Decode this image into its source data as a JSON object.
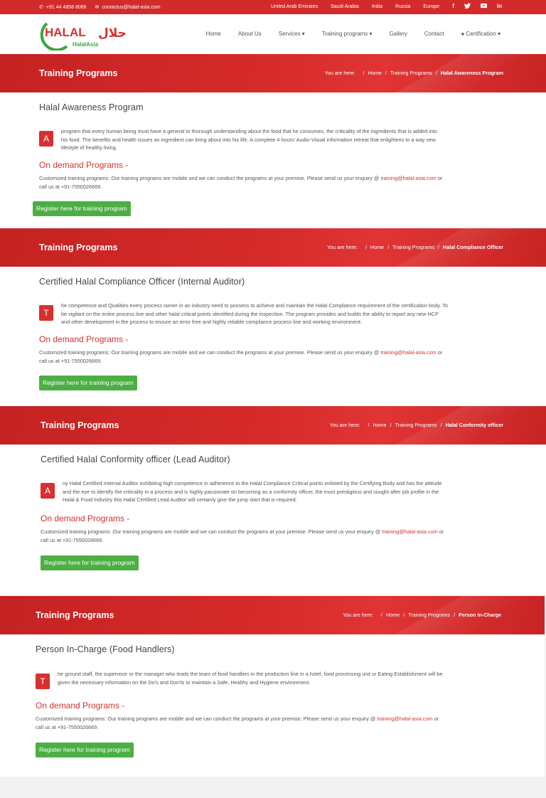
{
  "topbar": {
    "phone": "+91 44 4858 8066",
    "email": "contactus@halal-asia.com",
    "regions": [
      "United Arab Emirates",
      "Saudi Arabia",
      "India",
      "Russia",
      "Europe"
    ],
    "social": [
      "f",
      "t",
      "yt",
      "in"
    ]
  },
  "header": {
    "logo_text": "HALAL",
    "logo_subtext": "HalalAsia",
    "logo_arabic": "حلال",
    "nav": [
      "Home",
      "About Us",
      "Services ▾",
      "Training programs ▾",
      "Gallery",
      "Contact",
      "● Certification ▾"
    ]
  },
  "common": {
    "banner_title": "Training Programs",
    "you_are_here": "You are here:",
    "crumb_sep": "/",
    "crumb_home": "Home",
    "crumb_training": "Training Programs",
    "on_demand": "On demand Programs -",
    "custom_text": "Customized training programs: Our training programs are mobile and we can conduct the programs at your premise. Please send us your enquiry @",
    "custom_email": "training@halal-asia.com",
    "custom_or": "or",
    "custom_call": "call us at +91-7550026669.",
    "register_button": "Register here for training program"
  },
  "programs": [
    {
      "crumb": "Halal Awareness Program",
      "title": "Halal Awareness Program",
      "dropcap": "A",
      "lines": [
        "program that every human being must have a general to thorough understanding about the food that he consumes, the criticality of the ingredients that is added into",
        "his food. The benefits and health issues an ingredient can bring about into his life. A complete 4 hours' Audio-Visual information retreat that enlightens to a way new",
        "lifestyle of healthy living."
      ]
    },
    {
      "crumb": "Halal Compliance Officer",
      "title": "Certified Halal Compliance Officer (Internal Auditor)",
      "dropcap": "T",
      "lines": [
        "he competence and Qualities every process owner in an industry need to possess to achieve and maintain the Halal Compliance requirement of the certification body. To",
        "be vigilant on the entire process line and other halal critical points identified during the inspection. The program provides and builds the ability to report any new HCP",
        "and other development in the process to ensure an error free and highly reliable compliance process line and working environment."
      ]
    },
    {
      "crumb": "Halal Conformity officer",
      "title": "Certified Halal Conformity officer (Lead Auditor)",
      "dropcap": "A",
      "lines": [
        "ny Halal Certified Internal Auditor exhibiting high competence in adherence to the Halal Compliance Critical points enlisted by the Certifying Body and has the attitude",
        "and the eye to identify the criticality in a process and is highly passionate on becoming as a conformity officer, the most prestigious and sought after job profile in the",
        "Halal & Food Industry this Halal Certified Lead Auditor will certainly give the jump start that is required."
      ]
    },
    {
      "crumb": "Person In-Charge",
      "title": "Person In-Charge (Food Handlers)",
      "dropcap": "T",
      "lines": [
        "he ground staff, the supervisor or the manager who leads the team of food handlers in the production line in a hotel, food processing unit or Eating Establishment will be",
        "given the necessary information on the Do's and Don'ts to maintain a Safe, Healthy and Hygiene environment."
      ]
    }
  ],
  "colors": {
    "brand_red": "#d63030",
    "button_green": "#4caf43",
    "logo_green": "#3aa53a"
  }
}
